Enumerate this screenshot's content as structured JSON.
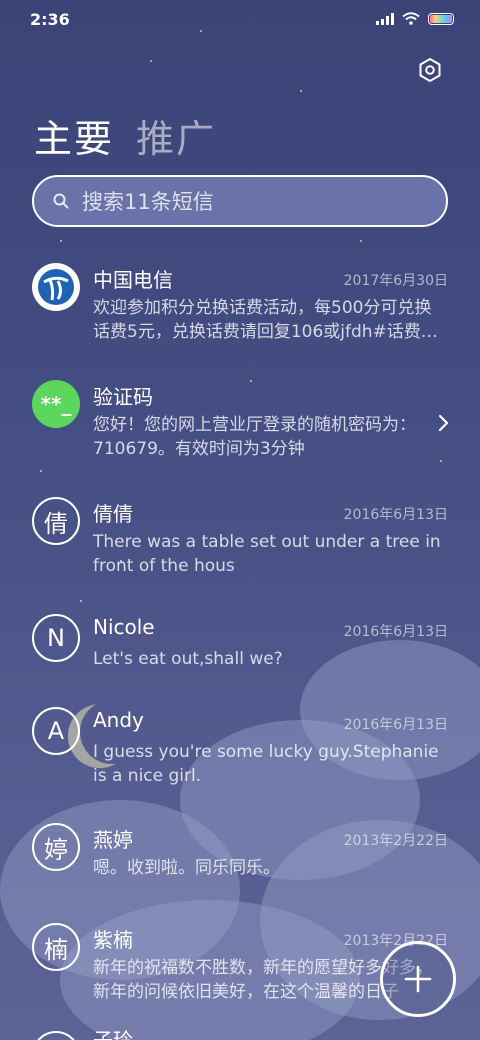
{
  "status_bar": {
    "time": "2:36"
  },
  "tabs": [
    {
      "label": "主要"
    },
    {
      "label": "推广"
    }
  ],
  "search": {
    "placeholder": "搜索11条短信"
  },
  "messages": [
    {
      "name": "中国电信",
      "date": "2017年6月30日",
      "preview": "欢迎参加积分兑换话费活动，每500分可兑换话费5元，兑换话费请回复106或jfdh#话费…"
    },
    {
      "name": "验证码",
      "avatar_text": "**_",
      "preview": "您好！您的网上营业厅登录的随机密码为：710679。有效时间为3分钟"
    },
    {
      "name": "倩倩",
      "avatar_text": "倩",
      "date": "2016年6月13日",
      "preview": "There was a table set out under a tree in front of the hous"
    },
    {
      "name": "Nicole",
      "avatar_text": "N",
      "date": "2016年6月13日",
      "preview": "Let's eat out,shall we?"
    },
    {
      "name": "Andy",
      "avatar_text": "A",
      "date": "2016年6月13日",
      "preview": "I guess you're some lucky guy.Stephanie is a nice girl."
    },
    {
      "name": "燕婷",
      "avatar_text": "婷",
      "date": "2013年2月22日",
      "preview": "嗯。收到啦。同乐同乐。"
    },
    {
      "name": "紫楠",
      "avatar_text": "楠",
      "date": "2013年2月22日",
      "preview": "新年的祝福数不胜数，新年的愿望好多好多，新年的问候依旧美好，在这个温馨的日子"
    },
    {
      "name": "子玲"
    }
  ],
  "colors": {
    "background": "#414b80",
    "verify_green": "#5cd65c",
    "telecom_blue": "#1f63b5"
  }
}
